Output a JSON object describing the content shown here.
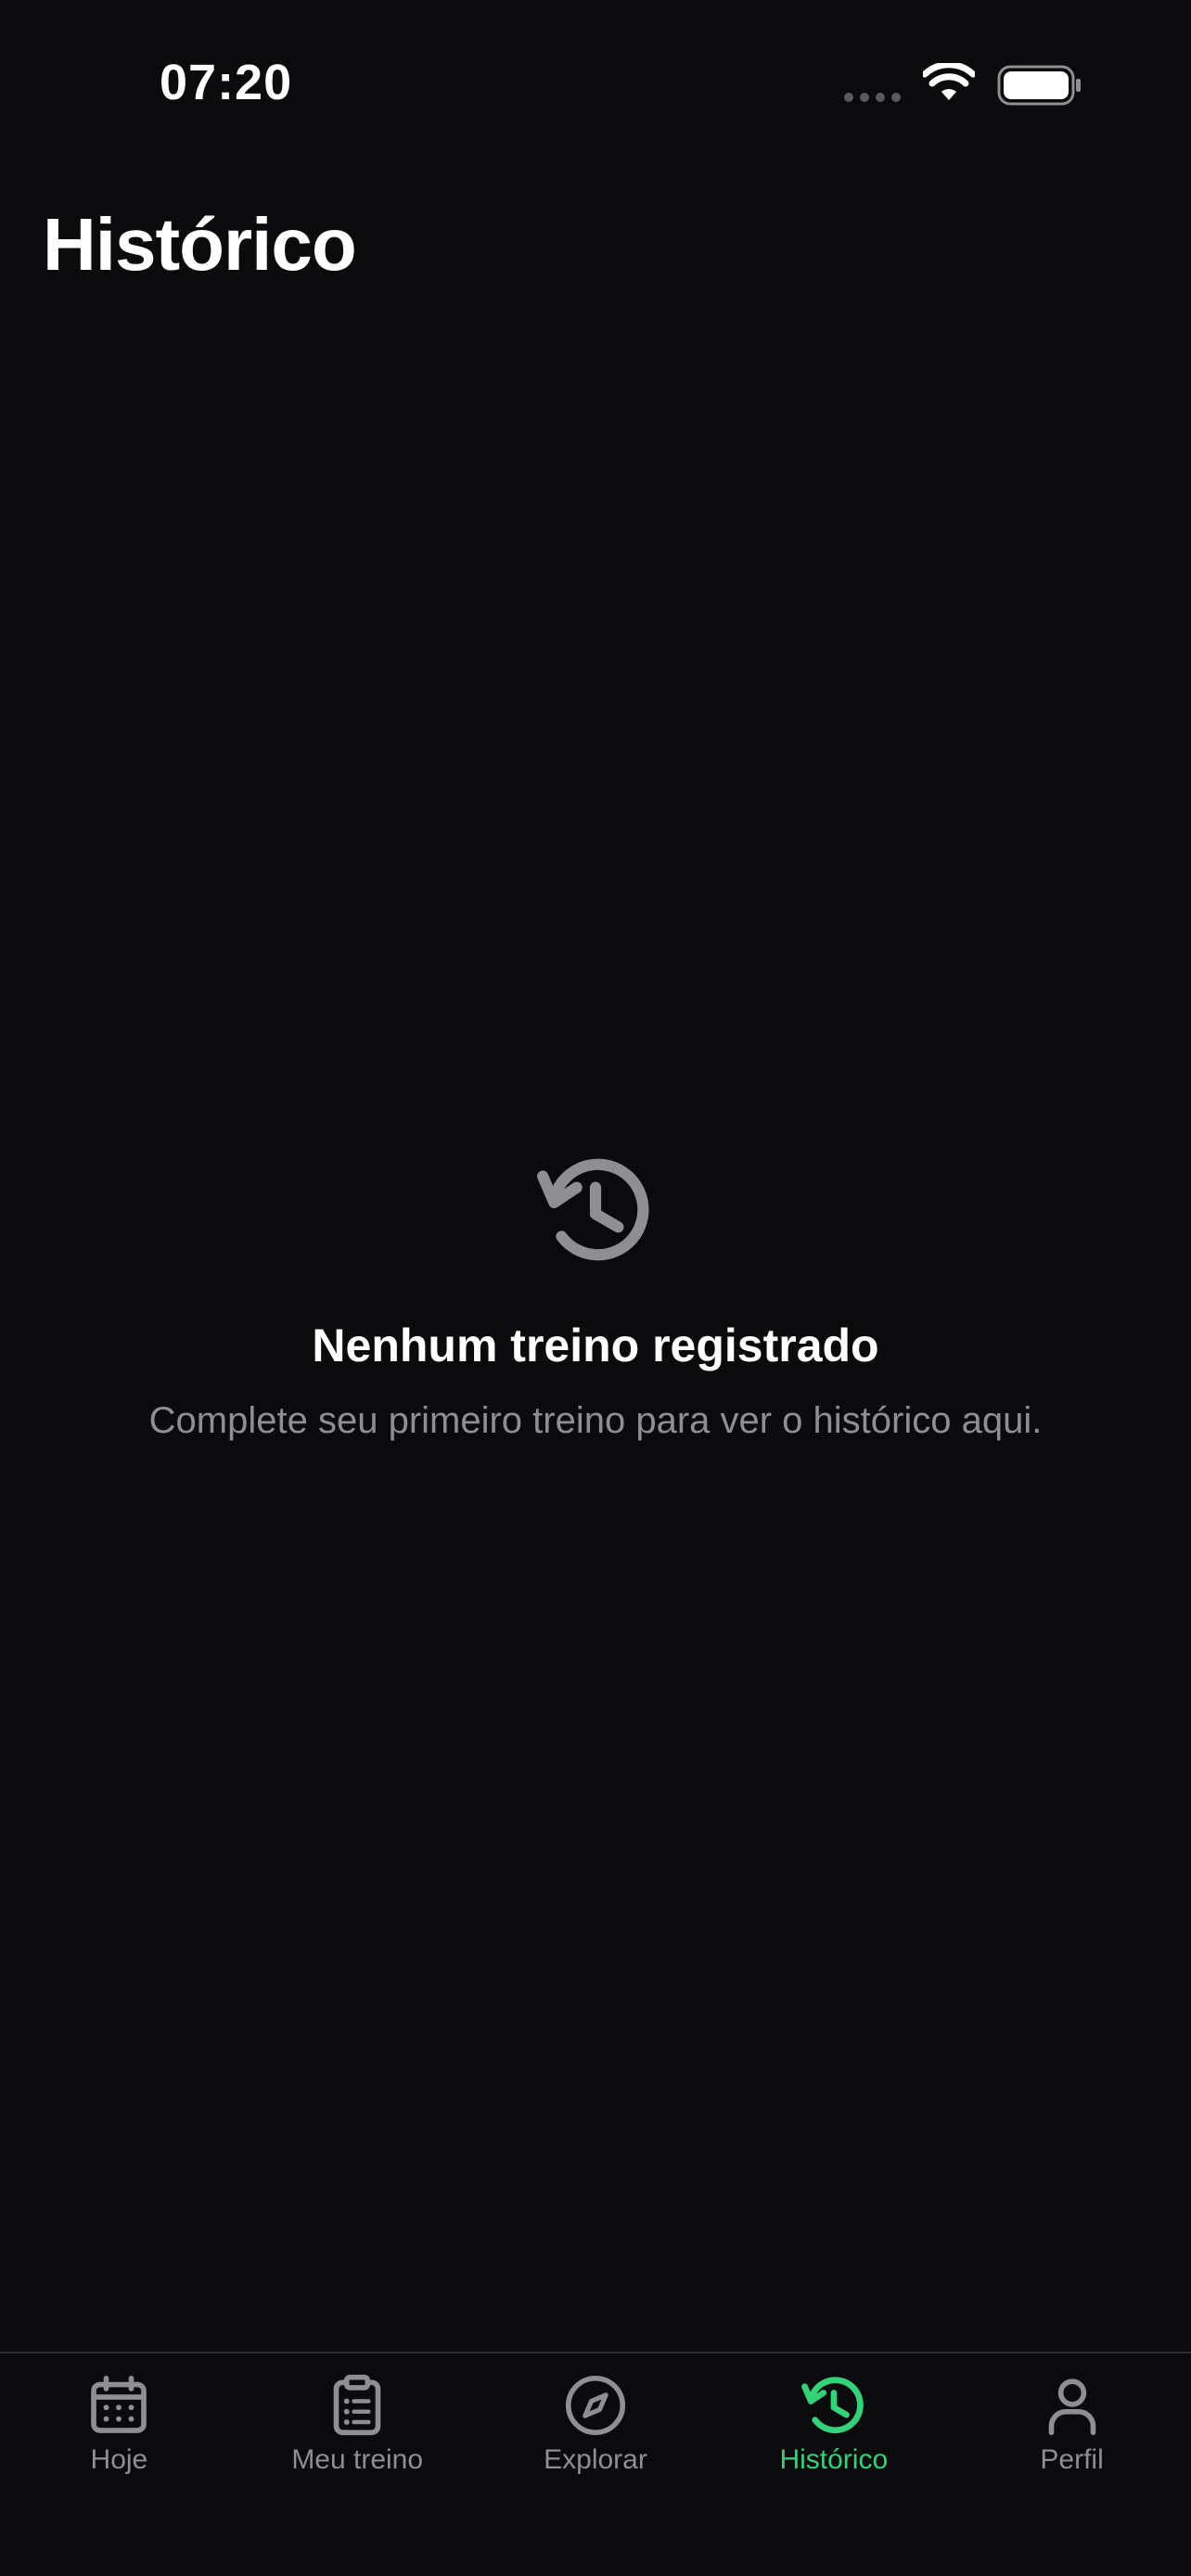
{
  "status_bar": {
    "time": "07:20"
  },
  "page": {
    "title": "Histórico"
  },
  "empty_state": {
    "icon": "history-icon",
    "title": "Nenhum treino registrado",
    "subtitle": "Complete seu primeiro treino para ver o histórico aqui."
  },
  "tab_bar": {
    "active_color": "#34d17a",
    "inactive_color": "#8e8e93",
    "tabs": [
      {
        "label": "Hoje",
        "icon": "calendar-icon",
        "active": false
      },
      {
        "label": "Meu treino",
        "icon": "clipboard-list-icon",
        "active": false
      },
      {
        "label": "Explorar",
        "icon": "compass-icon",
        "active": false
      },
      {
        "label": "Histórico",
        "icon": "history-icon",
        "active": true
      },
      {
        "label": "Perfil",
        "icon": "person-icon",
        "active": false
      }
    ]
  }
}
